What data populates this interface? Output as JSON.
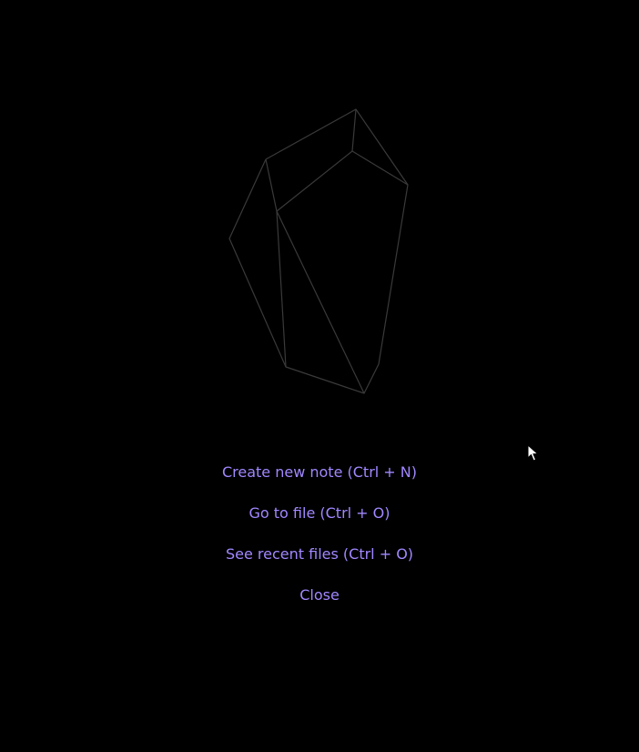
{
  "empty_state": {
    "logo_icon": "obsidian-crystal-icon",
    "actions": [
      {
        "label": "Create new note (Ctrl + N)"
      },
      {
        "label": "Go to file (Ctrl + O)"
      },
      {
        "label": "See recent files (Ctrl + O)"
      },
      {
        "label": "Close"
      }
    ]
  },
  "colors": {
    "background": "#000000",
    "link": "#a187ff",
    "logo_stroke": "#3a3a3a"
  },
  "cursor_icon": "mouse-pointer-icon"
}
